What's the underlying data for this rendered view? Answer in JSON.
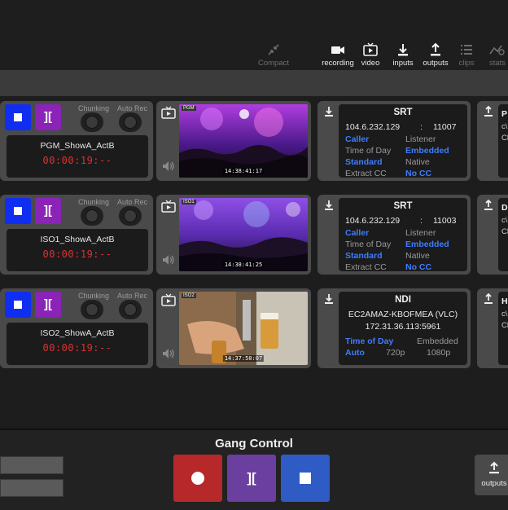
{
  "toolbar": {
    "items": [
      {
        "label": "Compact",
        "icon": "compact-arrows-icon",
        "enabled": false
      },
      {
        "label": "recording",
        "icon": "video-camera-icon",
        "enabled": true
      },
      {
        "label": "video",
        "icon": "tv-icon",
        "enabled": true
      },
      {
        "label": "inputs",
        "icon": "download-icon",
        "enabled": true
      },
      {
        "label": "outputs",
        "icon": "upload-icon",
        "enabled": true
      },
      {
        "label": "clips",
        "icon": "list-icon",
        "enabled": false
      },
      {
        "label": "stats",
        "icon": "stats-chart-icon",
        "enabled": false
      }
    ]
  },
  "rows": [
    {
      "chunking_label": "Chunking",
      "autorec_label": "Auto Rec",
      "split_glyph": "][",
      "name": "PGM_ShowA_ActB",
      "timecode": "00:00:19:--",
      "preview_badge": "PGM",
      "preview_timestamp": "14:38:41:17",
      "source": {
        "protocol": "SRT",
        "address": "104.6.232.129",
        "sep": ":",
        "port": "11007",
        "mode_active": "Caller",
        "mode_other": "Listener",
        "timing_other": "Time of Day",
        "timing_active": "Embedded",
        "sync_active": "Standard",
        "sync_other": "Native",
        "cc_other": "Extract CC",
        "cc_active": "No CC"
      },
      "output": {
        "line1": "P",
        "line2": "c\\",
        "line3": "Cl"
      }
    },
    {
      "chunking_label": "Chunking",
      "autorec_label": "Auto Rec",
      "split_glyph": "][",
      "name": "ISO1_ShowA_ActB",
      "timecode": "00:00:19:--",
      "preview_badge": "ISO1",
      "preview_timestamp": "14:38:41:25",
      "source": {
        "protocol": "SRT",
        "address": "104.6.232.129",
        "sep": ":",
        "port": "11003",
        "mode_active": "Caller",
        "mode_other": "Listener",
        "timing_other": "Time of Day",
        "timing_active": "Embedded",
        "sync_active": "Standard",
        "sync_other": "Native",
        "cc_other": "Extract CC",
        "cc_active": "No CC"
      },
      "output": {
        "line1": "D",
        "line2": "c\\",
        "line3": "Cl"
      }
    },
    {
      "chunking_label": "Chunking",
      "autorec_label": "Auto Rec",
      "split_glyph": "][",
      "name": "ISO2_ShowA_ActB",
      "timecode": "00:00:19:--",
      "preview_badge": "ISO2",
      "preview_timestamp": "14:37:50:07",
      "source": {
        "protocol": "NDI",
        "device": "EC2AMAZ-KBOFMEA (VLC)",
        "address": "172.31.36.113:5961",
        "timing_active": "Time of Day",
        "timing_other": "Embedded",
        "res_active": "Auto",
        "res_1": "720p",
        "res_2": "1080p"
      },
      "output": {
        "line1": "H",
        "line2": "c\\",
        "line3": "Cl"
      }
    }
  ],
  "gang": {
    "title": "Gang Control",
    "split_glyph": "][",
    "outputs_label": "outputs"
  },
  "colors": {
    "stop_blue": "#0f2ef0",
    "split_purple": "#8a23b6",
    "timecode_red": "#e03030",
    "active_blue": "#3e7cff",
    "gang_record": "#b7282b",
    "gang_split": "#6b3fa0",
    "gang_stop": "#2f5bc4"
  }
}
